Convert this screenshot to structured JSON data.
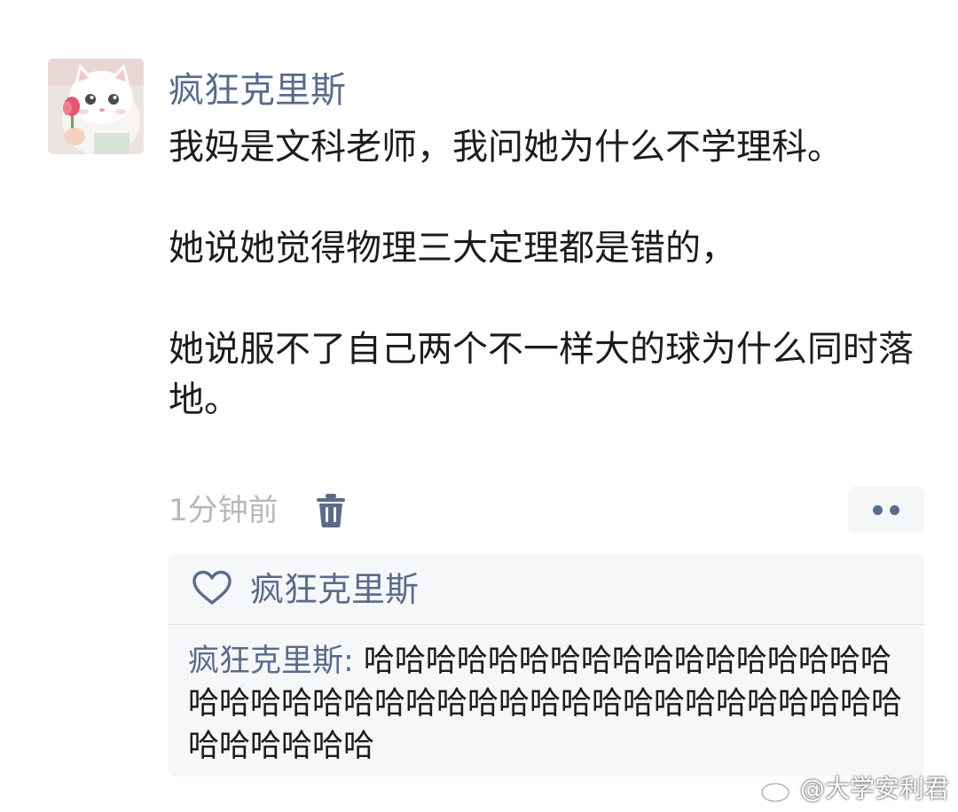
{
  "post": {
    "author": "疯狂克里斯",
    "text": "我妈是文科老师，我问她为什么不学理科。\n\n她说她觉得物理三大定理都是错的，\n\n她说服不了自己两个不一样大的球为什么同时落地。",
    "time": "1分钟前"
  },
  "likes": {
    "users": "疯狂克里斯"
  },
  "comment": {
    "author": "疯狂克里斯:",
    "text": " 哈哈哈哈哈哈哈哈哈哈哈哈哈哈哈哈哈哈哈哈哈哈哈哈哈哈哈哈哈哈哈哈哈哈哈哈哈哈哈哈哈哈哈哈哈哈"
  },
  "watermark": {
    "text": "@大学安利君"
  },
  "colors": {
    "accent": "#5b6b8c",
    "text": "#1c1c1c",
    "muted": "#b8b8b8",
    "panel": "#f6f7f9"
  },
  "icons": [
    "avatar-cat-image",
    "trash-icon",
    "more-icon",
    "heart-icon",
    "weibo-icon"
  ]
}
